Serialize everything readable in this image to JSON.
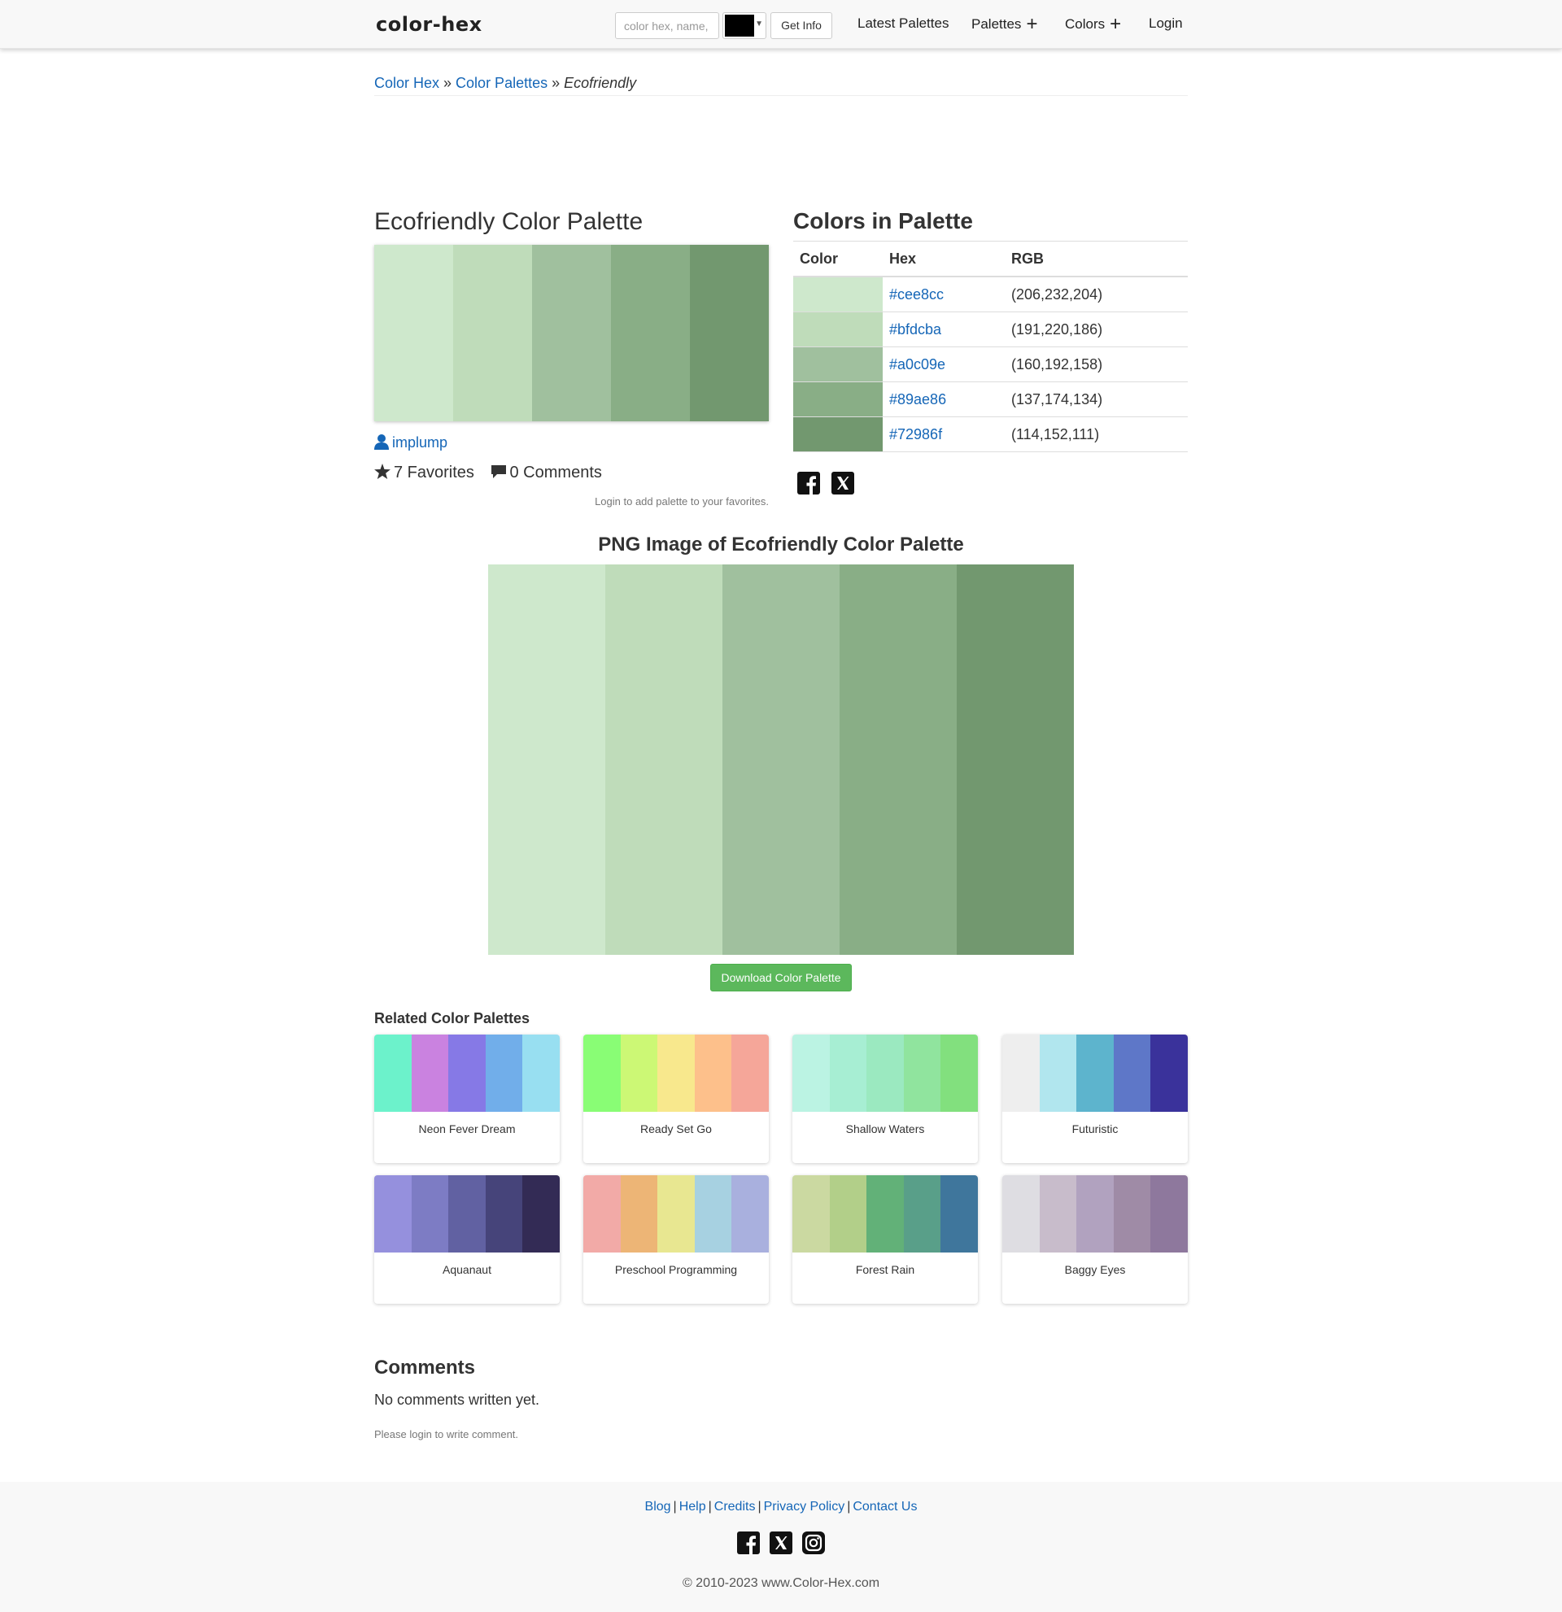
{
  "header": {
    "logo": "color-hex",
    "search_placeholder": "color hex, name, rgb",
    "get_info_label": "Get Info",
    "nav": {
      "latest": "Latest Palettes",
      "palettes": "Palettes",
      "colors": "Colors",
      "login": "Login"
    }
  },
  "breadcrumb": {
    "home": "Color Hex",
    "section": "Color Palettes",
    "current": "Ecofriendly",
    "separator": "»"
  },
  "palette": {
    "title": "Ecofriendly Color Palette",
    "colors": [
      "#cee8cc",
      "#bfdcba",
      "#a0c09e",
      "#89ae86",
      "#72986f"
    ],
    "author": "implump",
    "favorites": "7 Favorites",
    "comments": "0 Comments",
    "login_to_favorite": "Login to add palette to your favorites."
  },
  "colors_table": {
    "title": "Colors in Palette",
    "headers": [
      "Color",
      "Hex",
      "RGB"
    ],
    "rows": [
      {
        "hex": "#cee8cc",
        "rgb": "(206,232,204)"
      },
      {
        "hex": "#bfdcba",
        "rgb": "(191,220,186)"
      },
      {
        "hex": "#a0c09e",
        "rgb": "(160,192,158)"
      },
      {
        "hex": "#89ae86",
        "rgb": "(137,174,134)"
      },
      {
        "hex": "#72986f",
        "rgb": "(114,152,111)"
      }
    ]
  },
  "png_section": {
    "title": "PNG Image of Ecofriendly Color Palette",
    "download_label": "Download Color Palette"
  },
  "related": {
    "title": "Related Color Palettes",
    "items": [
      {
        "name": "Neon Fever Dream",
        "colors": [
          "#6cf2cb",
          "#ca82e0",
          "#8679e6",
          "#71aeea",
          "#98dff1"
        ]
      },
      {
        "name": "Ready Set Go",
        "colors": [
          "#89fd75",
          "#ccf875",
          "#f8e88d",
          "#fdc08b",
          "#f5a699"
        ]
      },
      {
        "name": "Shallow Waters",
        "colors": [
          "#bbf3e3",
          "#a7eed3",
          "#9be9c0",
          "#90e49e",
          "#82e07e"
        ]
      },
      {
        "name": "Futuristic",
        "colors": [
          "#eeeeee",
          "#b1e6ee",
          "#5db4cd",
          "#5e77c8",
          "#3a329b"
        ]
      },
      {
        "name": "Aquanaut",
        "colors": [
          "#9590dd",
          "#7d7cc4",
          "#6161a2",
          "#46447a",
          "#332b55"
        ]
      },
      {
        "name": "Preschool Programming",
        "colors": [
          "#f2aaa7",
          "#edb576",
          "#e8e791",
          "#a7d1e1",
          "#a9b0de"
        ]
      },
      {
        "name": "Forest Rain",
        "colors": [
          "#cbd9a1",
          "#b2cf89",
          "#62b178",
          "#599f89",
          "#3f769c"
        ]
      },
      {
        "name": "Baggy Eyes",
        "colors": [
          "#dedde2",
          "#c8bccb",
          "#b1a2bf",
          "#9f8ba6",
          "#8e789d"
        ]
      }
    ]
  },
  "comments": {
    "title": "Comments",
    "empty": "No comments written yet.",
    "login_prompt": "Please login to write comment."
  },
  "footer": {
    "links": [
      "Blog",
      "Help",
      "Credits",
      "Privacy Policy",
      "Contact Us"
    ],
    "copyright": "© 2010-2023 www.Color-Hex.com"
  },
  "icons": {
    "user": "user-icon",
    "star": "star-icon",
    "comment": "comment-icon",
    "facebook": "facebook-icon",
    "x": "x-icon",
    "instagram": "instagram-icon"
  }
}
